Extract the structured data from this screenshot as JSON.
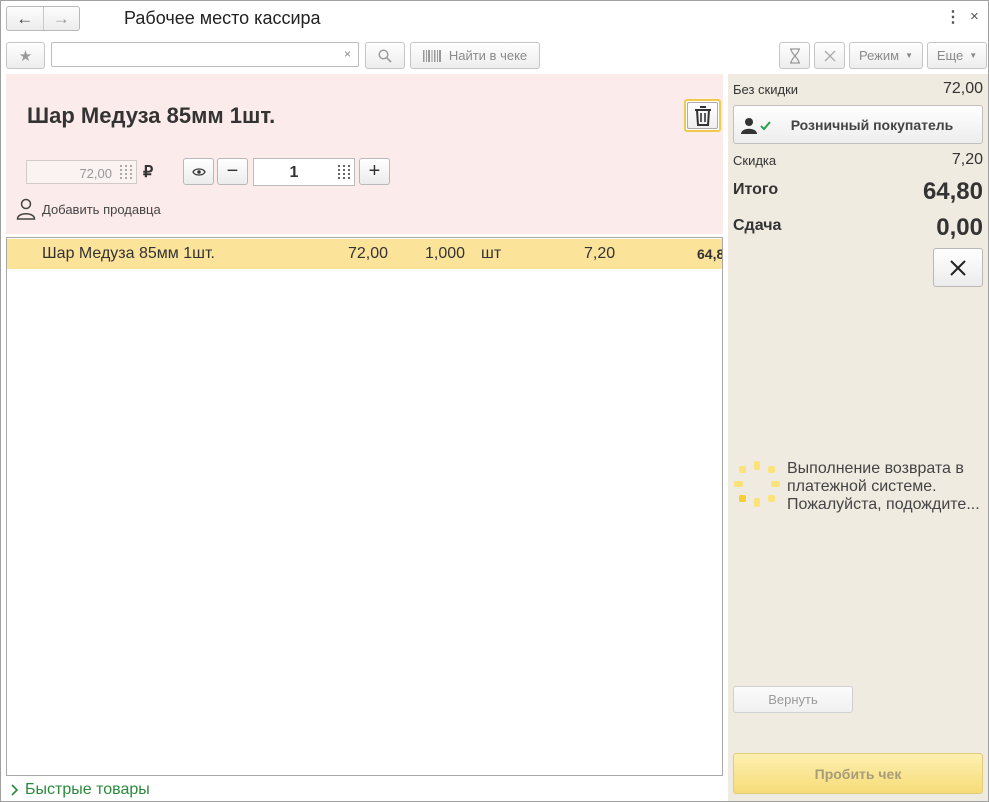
{
  "window": {
    "title": "Рабочее место кассира",
    "back_icon": "←",
    "forward_icon": "→",
    "menu_icon": "⋮",
    "close_icon": "×"
  },
  "toolbar": {
    "favorite_icon": "★",
    "search_value": "",
    "search_clear": "×",
    "find_in_receipt_label": "Найти в чеке",
    "mode_label": "Режим",
    "more_label": "Еще"
  },
  "entry": {
    "item_name": "Шар Медуза 85мм 1шт.",
    "price": "72,00",
    "currency_symbol": "₽",
    "quantity": "1",
    "minus_label": "−",
    "plus_label": "+",
    "add_seller_label": "Добавить продавца"
  },
  "table": {
    "rows": [
      {
        "name": "Шар Медуза 85мм 1шт.",
        "price": "72,00",
        "quantity": "1,000",
        "unit": "шт",
        "discount": "7,20",
        "sum": "64,8"
      }
    ]
  },
  "quick_goods_label": "Быстрые товары",
  "summary": {
    "no_discount_label": "Без скидки",
    "no_discount_value": "72,00",
    "customer_label": "Розничный покупатель",
    "discount_label": "Скидка",
    "discount_value": "7,20",
    "total_label": "Итого",
    "total_value": "64,80",
    "change_label": "Сдача",
    "change_value": "0,00",
    "waiting_text": "Выполнение возврата в платежной системе. Пожалуйста, подождите...",
    "return_label": "Вернуть",
    "pay_label": "Пробить чек"
  },
  "colors": {
    "accent_yellow": "#f6dc78",
    "selected_row": "#fbe39a",
    "entry_panel_bg": "#fcebeb",
    "side_panel_bg": "#efebe1",
    "quick_goods_green": "#2a8a3a"
  }
}
